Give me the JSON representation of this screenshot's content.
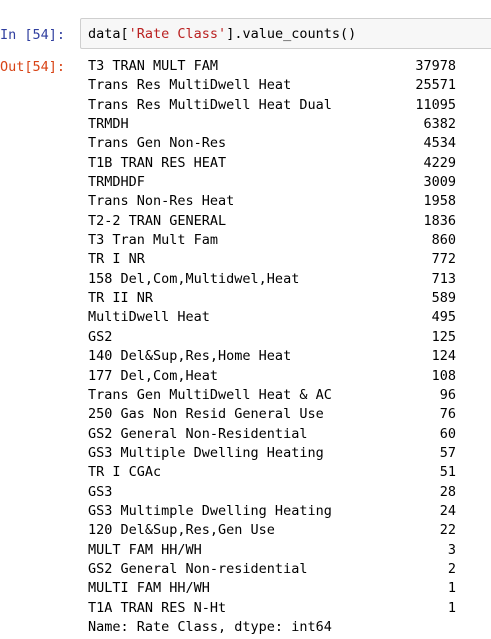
{
  "input_cell": {
    "prompt": "In [54]:",
    "code_prefix": "data[",
    "code_string": "'Rate Class'",
    "code_suffix": "].value_counts()"
  },
  "output_cell": {
    "prompt": "Out[54]:",
    "rows": [
      {
        "label": "T3 TRAN MULT FAM",
        "count": "37978"
      },
      {
        "label": "Trans Res MultiDwell Heat",
        "count": "25571"
      },
      {
        "label": "Trans Res MultiDwell Heat Dual",
        "count": "11095"
      },
      {
        "label": "TRMDH",
        "count": "6382"
      },
      {
        "label": "Trans Gen Non-Res",
        "count": "4534"
      },
      {
        "label": "T1B TRAN RES HEAT",
        "count": "4229"
      },
      {
        "label": "TRMDHDF",
        "count": "3009"
      },
      {
        "label": "Trans Non-Res Heat",
        "count": "1958"
      },
      {
        "label": "T2-2 TRAN GENERAL",
        "count": "1836"
      },
      {
        "label": "T3 Tran Mult Fam",
        "count": "860"
      },
      {
        "label": "TR I NR",
        "count": "772"
      },
      {
        "label": "158 Del,Com,Multidwel,Heat",
        "count": "713"
      },
      {
        "label": "TR II NR",
        "count": "589"
      },
      {
        "label": "MultiDwell Heat",
        "count": "495"
      },
      {
        "label": "GS2",
        "count": "125"
      },
      {
        "label": "140 Del&Sup,Res,Home Heat",
        "count": "124"
      },
      {
        "label": "177 Del,Com,Heat",
        "count": "108"
      },
      {
        "label": "Trans Gen MultiDwell Heat & AC",
        "count": "96"
      },
      {
        "label": "250 Gas Non Resid General Use",
        "count": "76"
      },
      {
        "label": "GS2 General Non-Residential",
        "count": "60"
      },
      {
        "label": "GS3 Multiple Dwelling Heating",
        "count": "57"
      },
      {
        "label": "TR I CGAc",
        "count": "51"
      },
      {
        "label": "GS3",
        "count": "28"
      },
      {
        "label": "GS3 Multimple Dwelling Heating",
        "count": "24"
      },
      {
        "label": "120 Del&Sup,Res,Gen Use",
        "count": "22"
      },
      {
        "label": "MULT FAM HH/WH",
        "count": "3"
      },
      {
        "label": "GS2 General Non-residential",
        "count": "2"
      },
      {
        "label": "MULTI FAM HH/WH",
        "count": "1"
      },
      {
        "label": "T1A TRAN RES N-Ht",
        "count": "1"
      }
    ],
    "footer": "Name: Rate Class, dtype: int64"
  }
}
